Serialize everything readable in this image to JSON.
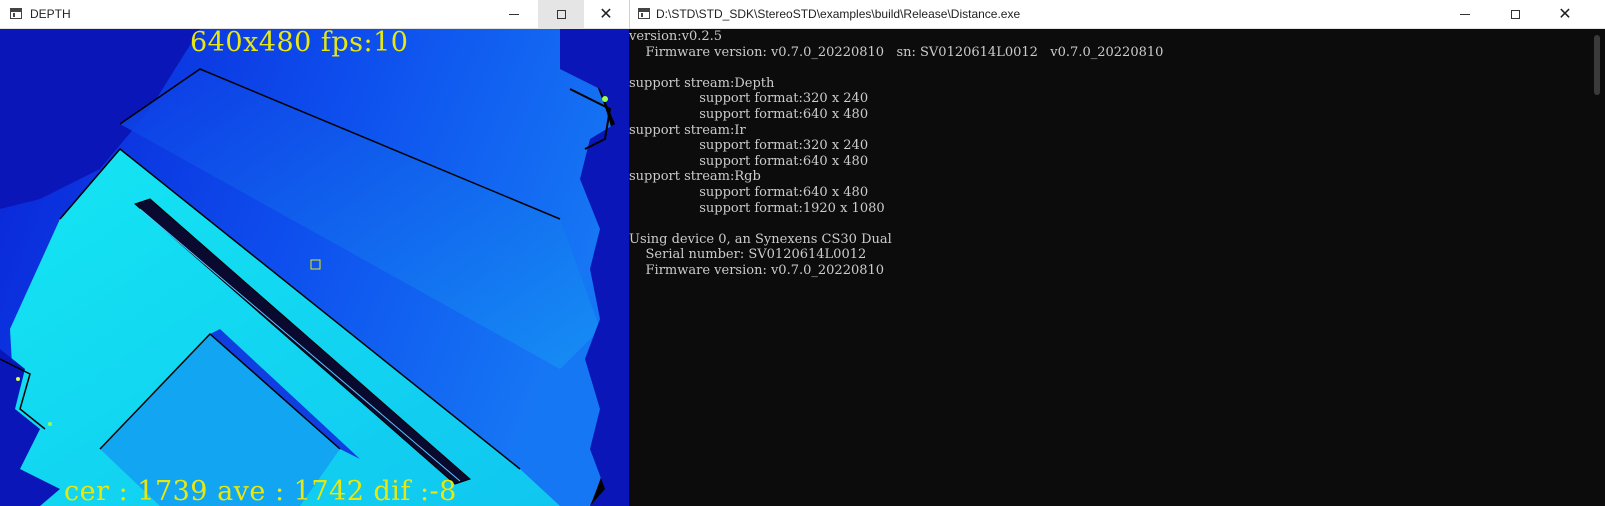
{
  "depth_window": {
    "title": "DEPTH",
    "controls": {
      "minimize": "minimize",
      "maximize": "maximize",
      "close": "close"
    },
    "overlay_top": "640x480 fps:10",
    "overlay_bottom": "cer : 1739 ave : 1742 dif :-8",
    "colors": {
      "overlay_text": "#e8e80e",
      "far": "#0a1fd8",
      "mid": "#0f60f2",
      "near": "#12e8f0"
    }
  },
  "console_window": {
    "title": "D:\\STD\\STD_SDK\\StereoSTD\\examples\\build\\Release\\Distance.exe",
    "lines": [
      "version:v0.2.5",
      "    Firmware version: v0.7.0_20220810   sn: SV0120614L0012   v0.7.0_20220810",
      "",
      "support stream:Depth",
      "                 support format:320 x 240",
      "                 support format:640 x 480",
      "support stream:Ir",
      "                 support format:320 x 240",
      "                 support format:640 x 480",
      "support stream:Rgb",
      "                 support format:640 x 480",
      "                 support format:1920 x 1080",
      "",
      "Using device 0, an Synexens CS30 Dual",
      "    Serial number: SV0120614L0012",
      "    Firmware version: v0.7.0_20220810"
    ],
    "colors": {
      "background": "#0c0c0c",
      "text": "#cccccc"
    }
  }
}
